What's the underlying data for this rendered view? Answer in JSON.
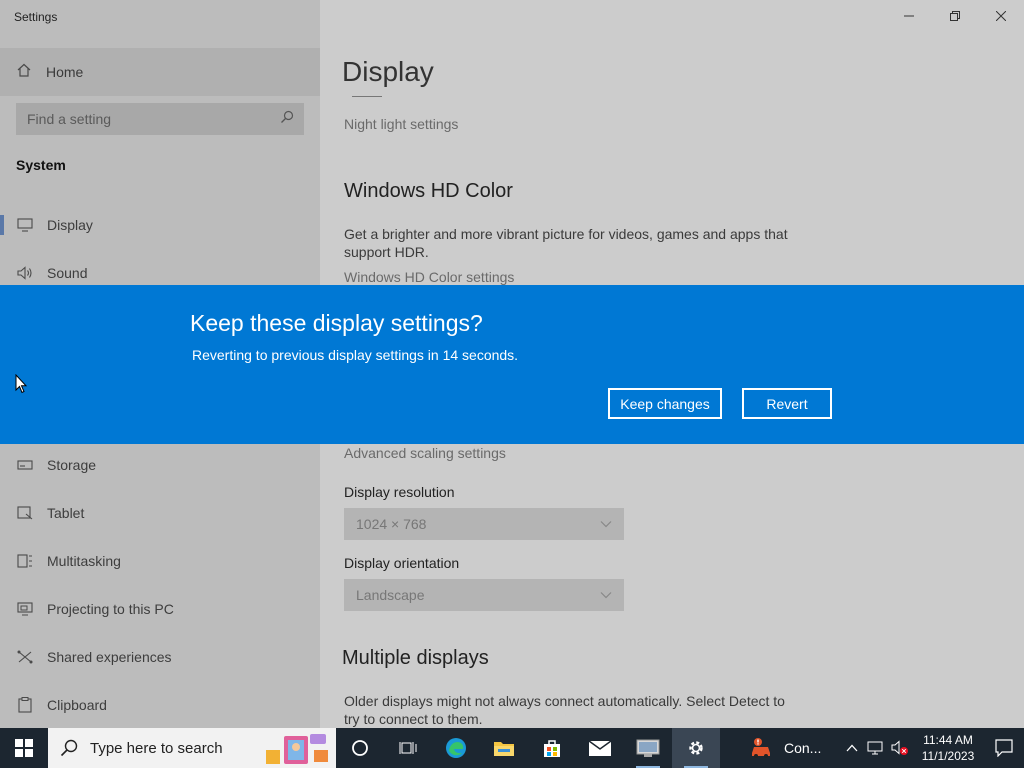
{
  "window": {
    "title": "Settings",
    "controls": [
      "minimize",
      "restore",
      "close"
    ]
  },
  "sidebar": {
    "home_label": "Home",
    "search_placeholder": "Find a setting",
    "section": "System",
    "items": [
      {
        "label": "Display",
        "icon": "monitor-icon"
      },
      {
        "label": "Sound",
        "icon": "speaker-icon"
      },
      {
        "label": "Storage",
        "icon": "storage-icon"
      },
      {
        "label": "Tablet",
        "icon": "tablet-icon"
      },
      {
        "label": "Multitasking",
        "icon": "multitasking-icon"
      },
      {
        "label": "Projecting to this PC",
        "icon": "projecting-icon"
      },
      {
        "label": "Shared experiences",
        "icon": "shared-experiences-icon"
      },
      {
        "label": "Clipboard",
        "icon": "clipboard-icon"
      }
    ]
  },
  "main": {
    "title": "Display",
    "night_light_link": "Night light settings",
    "hd_color_heading": "Windows HD Color",
    "hd_color_desc": "Get a brighter and more vibrant picture for videos, games and apps that support HDR.",
    "hd_color_link": "Windows HD Color settings",
    "advanced_scaling_link": "Advanced scaling settings",
    "resolution_label": "Display resolution",
    "resolution_value": "1024 × 768",
    "orientation_label": "Display orientation",
    "orientation_value": "Landscape",
    "multiple_heading": "Multiple displays",
    "multiple_desc": "Older displays might not always connect automatically. Select Detect to try to connect to them."
  },
  "dialog": {
    "title": "Keep these display settings?",
    "message": "Reverting to previous display settings in 14 seconds.",
    "keep_label": "Keep changes",
    "revert_label": "Revert",
    "color": "#0078d4"
  },
  "taskbar": {
    "search_placeholder": "Type here to search",
    "app_label": "Con...",
    "time": "11:44 AM",
    "date": "11/1/2023"
  }
}
